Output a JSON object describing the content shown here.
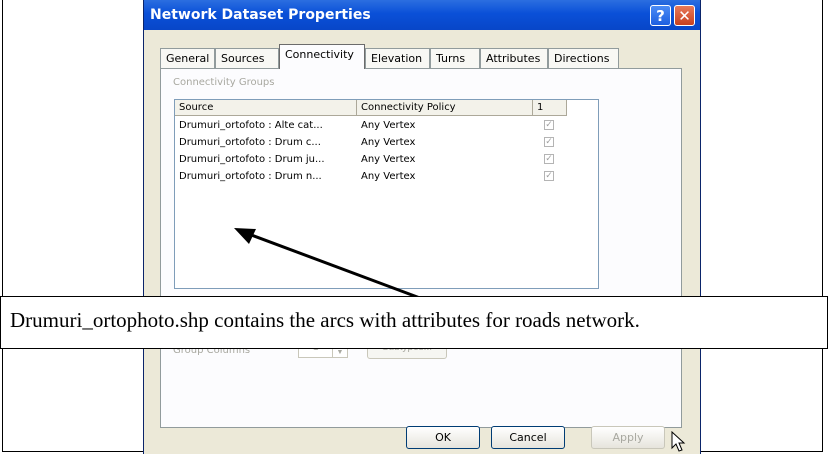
{
  "window": {
    "title": "Network Dataset Properties",
    "help_glyph": "?",
    "close_glyph": "✕"
  },
  "tabs": [
    {
      "label": "General"
    },
    {
      "label": "Sources"
    },
    {
      "label": "Connectivity"
    },
    {
      "label": "Elevation"
    },
    {
      "label": "Turns"
    },
    {
      "label": "Attributes"
    },
    {
      "label": "Directions"
    }
  ],
  "active_tab": "Connectivity",
  "connectivity": {
    "group_label": "Connectivity Groups",
    "columns": [
      "Source",
      "Connectivity Policy",
      "1"
    ],
    "rows": [
      {
        "source": "Drumuri_ortofoto : Alte cat...",
        "policy": "Any Vertex",
        "group1": true
      },
      {
        "source": "Drumuri_ortofoto : Drum c...",
        "policy": "Any Vertex",
        "group1": true
      },
      {
        "source": "Drumuri_ortofoto : Drum ju...",
        "policy": "Any Vertex",
        "group1": true
      },
      {
        "source": "Drumuri_ortofoto : Drum n...",
        "policy": "Any Vertex",
        "group1": true
      }
    ],
    "group_columns_label": "Group Columns",
    "group_columns_value": "1",
    "subtypes_label": "Subtypes..."
  },
  "buttons": {
    "ok": "OK",
    "cancel": "Cancel",
    "apply": "Apply"
  },
  "annotation": {
    "caption": "Drumuri_ortophoto.shp contains the arcs with attributes for roads network."
  },
  "colors": {
    "titlebar": "#0a50d8",
    "dialog_bg": "#ece9d8"
  }
}
